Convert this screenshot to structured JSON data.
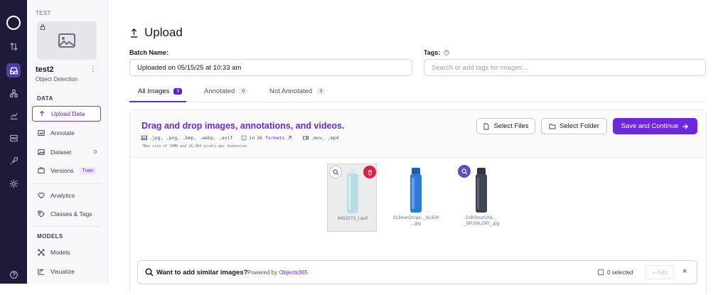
{
  "project": {
    "group_label": "TEST",
    "name": "test2",
    "type": "Object Detection"
  },
  "sidebar": {
    "data_section": "DATA",
    "models_section": "MODELS",
    "items": [
      {
        "label": "Upload Data",
        "icon": "upload-icon"
      },
      {
        "label": "Annotate",
        "icon": "annotate-icon"
      },
      {
        "label": "Dataset",
        "icon": "dataset-icon",
        "badge": "0"
      },
      {
        "label": "Versions",
        "icon": "versions-icon",
        "tag": "Train"
      },
      {
        "label": "Analytics",
        "icon": "analytics-icon"
      },
      {
        "label": "Classes & Tags",
        "icon": "tag-icon"
      },
      {
        "label": "Models",
        "icon": "models-icon"
      },
      {
        "label": "Visualize",
        "icon": "visualize-icon"
      }
    ]
  },
  "page": {
    "title": "Upload",
    "batch_label": "Batch Name:",
    "batch_value": "Uploaded on 05/15/25 at 10:33 am",
    "tags_label": "Tags:",
    "tags_placeholder": "Search or add tags for images..."
  },
  "tabs": [
    {
      "label": "All Images",
      "count": "3"
    },
    {
      "label": "Annotated",
      "count": "0"
    },
    {
      "label": "Not Annotated",
      "count": "3"
    }
  ],
  "dropzone": {
    "title": "Drag and drop images, annotations, and videos.",
    "image_formats": ".jpg, .png, .bmp, .webp, .avif",
    "annot_prefix": "in",
    "annot_link": "26 formats",
    "video_formats": ".mov, .mp4",
    "note": "*Max size of 20MB and 16,384 pixels per dimension.",
    "select_files": "Select Files",
    "select_folder": "Select Folder",
    "save_continue": "Save and Continue"
  },
  "images": [
    {
      "caption1": "8453273_l.avif",
      "caption2": ""
    },
    {
      "caption1": "313AwrDcnpL._SL500",
      "caption2": "...jpg"
    },
    {
      "caption1": "21BSlnorUNL._",
      "caption2": "_SR290,290_.jpg"
    }
  ],
  "similar": {
    "title": "Want to add similar images?",
    "powered_prefix": "Powered by",
    "powered_name": "Objects365",
    "selected": "0 selected",
    "add": "+ Add",
    "close": "×"
  },
  "colors": {
    "accent": "#6d28d9",
    "rail_bg": "#1e1b3a",
    "danger": "#e11d48"
  }
}
